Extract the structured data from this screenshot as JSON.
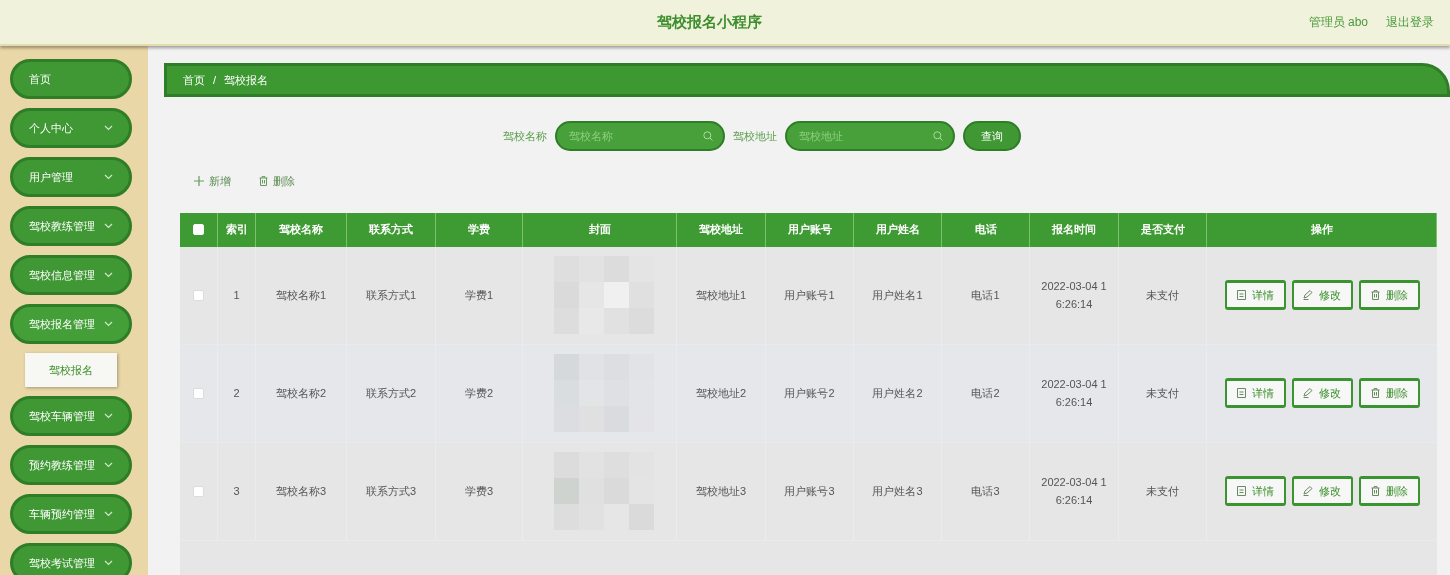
{
  "header": {
    "title": "驾校报名小程序",
    "user": "管理员 abo",
    "logout": "退出登录"
  },
  "sidebar": {
    "items": [
      {
        "label": "首页",
        "expandable": false
      },
      {
        "label": "个人中心",
        "expandable": true,
        "expanded": false
      },
      {
        "label": "用户管理",
        "expandable": true,
        "expanded": false
      },
      {
        "label": "驾校教练管理",
        "expandable": true,
        "expanded": false
      },
      {
        "label": "驾校信息管理",
        "expandable": true,
        "expanded": false
      },
      {
        "label": "驾校报名管理",
        "expandable": true,
        "expanded": true,
        "children": [
          {
            "label": "驾校报名",
            "selected": true
          }
        ]
      },
      {
        "label": "驾校车辆管理",
        "expandable": true,
        "expanded": false
      },
      {
        "label": "预约教练管理",
        "expandable": true,
        "expanded": false
      },
      {
        "label": "车辆预约管理",
        "expandable": true,
        "expanded": false
      },
      {
        "label": "驾校考试管理",
        "expandable": true,
        "expanded": false
      }
    ]
  },
  "breadcrumb": [
    "首页",
    "/",
    "驾校报名"
  ],
  "search": {
    "fields": [
      {
        "label": "驾校名称",
        "placeholder": "驾校名称"
      },
      {
        "label": "驾校地址",
        "placeholder": "驾校地址"
      }
    ],
    "button": "查询"
  },
  "actions": [
    {
      "kind": "add",
      "label": "新增"
    },
    {
      "kind": "delete",
      "label": "删除"
    }
  ],
  "table": {
    "all_checked": false,
    "columns": [
      "索引",
      "驾校名称",
      "联系方式",
      "学费",
      "封面",
      "驾校地址",
      "用户账号",
      "用户姓名",
      "电话",
      "报名时间",
      "是否支付",
      "操作"
    ],
    "rows": [
      {
        "checked": false,
        "cells": [
          "1",
          "驾校名称1",
          "联系方式1",
          "学费1",
          {
            "kind": "picture"
          },
          "驾校地址1",
          "用户账号1",
          "用户姓名1",
          "电话1",
          "2022-03-04 1\n6:26:14",
          "未支付"
        ],
        "buttons": [
          {
            "kind": "detail",
            "label": "详情"
          },
          {
            "kind": "edit",
            "label": "修改"
          },
          {
            "kind": "delete",
            "label": "删除"
          }
        ]
      },
      {
        "checked": false,
        "cells": [
          "2",
          "驾校名称2",
          "联系方式2",
          "学费2",
          {
            "kind": "picture"
          },
          "驾校地址2",
          "用户账号2",
          "用户姓名2",
          "电话2",
          "2022-03-04 1\n6:26:14",
          "未支付"
        ],
        "buttons": [
          {
            "kind": "detail",
            "label": "详情"
          },
          {
            "kind": "edit",
            "label": "修改"
          },
          {
            "kind": "delete",
            "label": "删除"
          }
        ]
      },
      {
        "checked": false,
        "cells": [
          "3",
          "驾校名称3",
          "联系方式3",
          "学费3",
          {
            "kind": "picture"
          },
          "驾校地址3",
          "用户账号3",
          "用户姓名3",
          "电话3",
          "2022-03-04 1\n6:26:14",
          "未支付"
        ],
        "buttons": [
          {
            "kind": "detail",
            "label": "详情"
          },
          {
            "kind": "edit",
            "label": "修改"
          },
          {
            "kind": "delete",
            "label": "删除"
          }
        ]
      }
    ]
  }
}
